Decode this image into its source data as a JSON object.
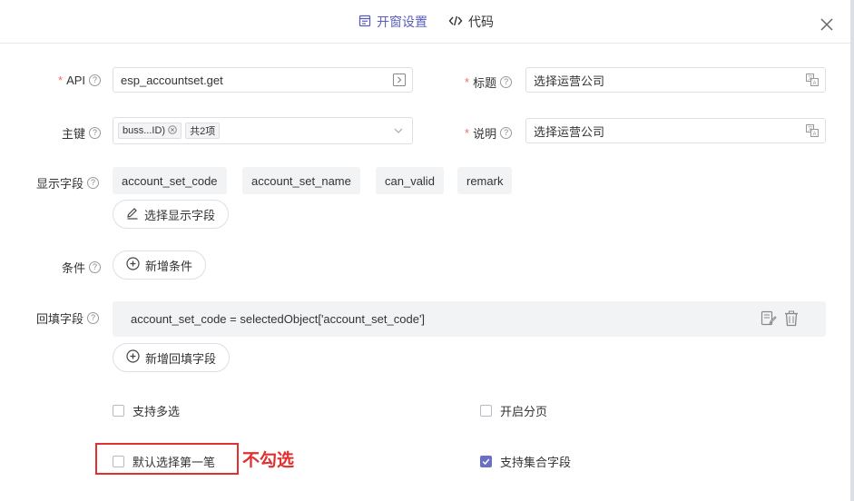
{
  "tabs": [
    {
      "label": "开窗设置",
      "active": true
    },
    {
      "label": "代码",
      "active": false
    }
  ],
  "form": {
    "api": {
      "label": "API",
      "value": "esp_accountset.get"
    },
    "title": {
      "label": "标题",
      "value": "选择运营公司"
    },
    "primary_key": {
      "label": "主键",
      "tag": "buss...ID)",
      "count": "共2项"
    },
    "description": {
      "label": "说明",
      "value": "选择运营公司"
    },
    "display_fields": {
      "label": "显示字段",
      "items": [
        "account_set_code",
        "account_set_name",
        "can_valid",
        "remark"
      ],
      "button": "选择显示字段"
    },
    "condition": {
      "label": "条件",
      "button": "新增条件"
    },
    "backfill": {
      "label": "回填字段",
      "rows": [
        "account_set_code = selectedObject['account_set_code']"
      ],
      "button": "新增回填字段"
    }
  },
  "options": {
    "multi_select": {
      "label": "支持多选",
      "checked": false
    },
    "paging": {
      "label": "开启分页",
      "checked": false
    },
    "default_first": {
      "label": "默认选择第一笔",
      "checked": false
    },
    "collection_field": {
      "label": "支持集合字段",
      "checked": true
    }
  },
  "annotation": {
    "text": "不勾选",
    "color": "#e0302f"
  },
  "colors": {
    "accent": "#5a5eb9",
    "required": "#f56c6c",
    "checkbox": "#6b6fc4"
  }
}
